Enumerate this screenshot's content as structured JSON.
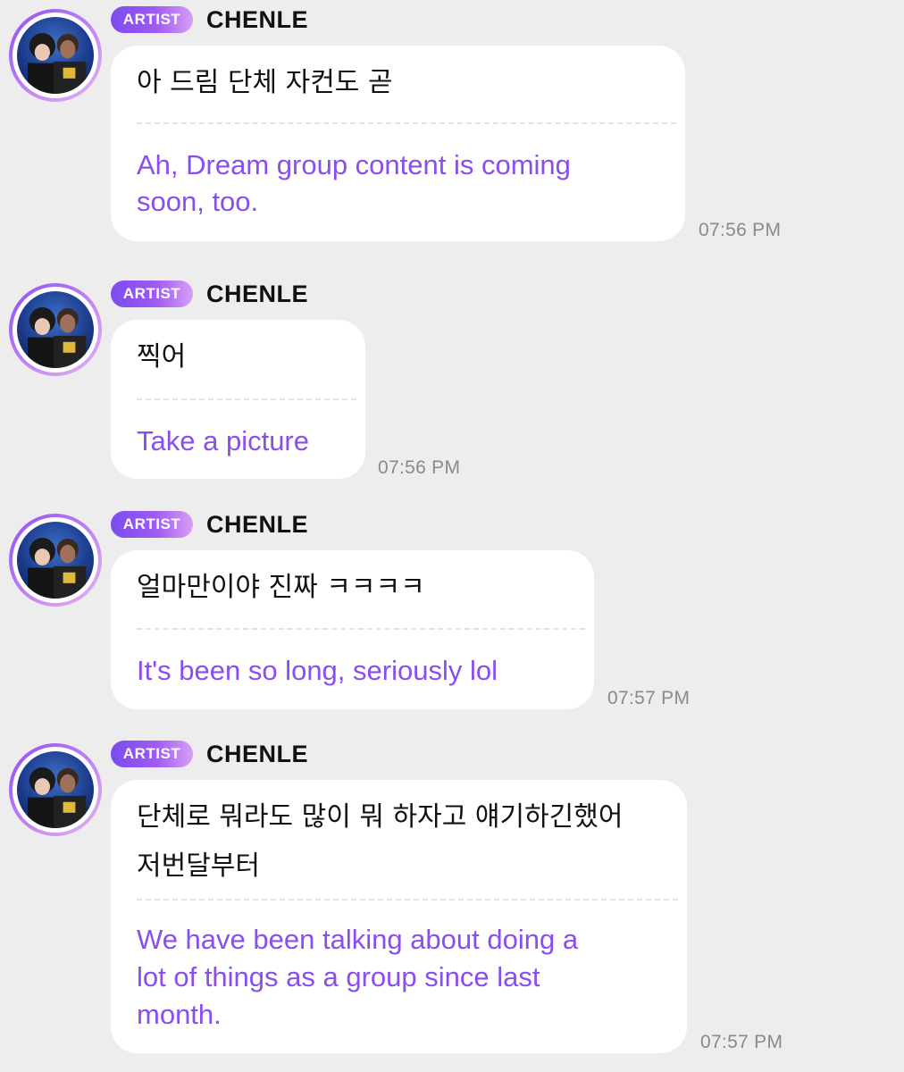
{
  "messages": [
    {
      "badge": "ARTIST",
      "name": "CHENLE",
      "korean": [
        "아 드림 단체 자컨도 곧"
      ],
      "english": [
        "Ah, Dream group content is coming",
        "soon, too."
      ],
      "time": "07:56 PM"
    },
    {
      "badge": "ARTIST",
      "name": "CHENLE",
      "korean": [
        "찍어"
      ],
      "english": [
        "Take a picture"
      ],
      "time": "07:56 PM"
    },
    {
      "badge": "ARTIST",
      "name": "CHENLE",
      "korean": [
        "얼마만이야 진짜 ㅋㅋㅋㅋ"
      ],
      "english": [
        "It's been so long, seriously lol"
      ],
      "time": "07:57 PM"
    },
    {
      "badge": "ARTIST",
      "name": "CHENLE",
      "korean": [
        "단체로 뭐라도 많이 뭐 하자고 얘기하긴했어",
        "저번달부터"
      ],
      "english": [
        "We have been talking about doing a",
        "lot of things as a group since last",
        "month."
      ],
      "time": "07:57 PM"
    }
  ],
  "colors": {
    "background": "#ededed",
    "bubble": "#ffffff",
    "translation_text": "#8a4ef0",
    "badge_gradient": [
      "#7a4cf0",
      "#d69ff4"
    ],
    "timestamp": "#8a8a8a"
  },
  "icons": {
    "avatar": "artist-profile-photo"
  }
}
